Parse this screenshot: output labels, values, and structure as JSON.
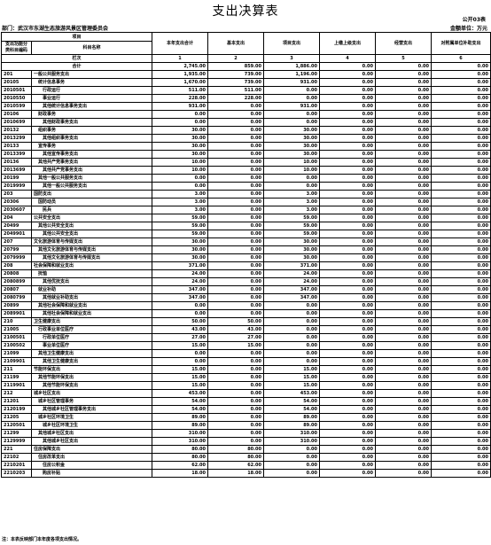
{
  "title": "支出决算表",
  "form_id": "公开03表",
  "org": "部门：武汉市东湖生态旅游风景区管理委员会",
  "unit": "金额单位：万元",
  "headers": {
    "item": "项目",
    "code": "支出功能分类科目编码",
    "name": "科目名称",
    "colno": "栏次",
    "cols": [
      "本年支出合计",
      "基本支出",
      "项目支出",
      "上缴上级支出",
      "经营支出",
      "对附属单位补助支出"
    ],
    "nums": [
      "1",
      "2",
      "3",
      "4",
      "5",
      "6"
    ]
  },
  "total": {
    "label": "合计",
    "values": [
      "2,745.00",
      "859.00",
      "1,886.00",
      "0.00",
      "0.00",
      "0.00"
    ]
  },
  "rows": [
    [
      "201",
      "一般公共服务支出",
      "1,935.00",
      "739.00",
      "1,196.00",
      "0.00",
      "0.00",
      "0.00"
    ],
    [
      "20105",
      "统计信息事务",
      "1,670.00",
      "739.00",
      "931.00",
      "0.00",
      "0.00",
      "0.00"
    ],
    [
      "2010501",
      "行政运行",
      "511.00",
      "511.00",
      "0.00",
      "0.00",
      "0.00",
      "0.00"
    ],
    [
      "2010550",
      "事业运行",
      "228.00",
      "228.00",
      "0.00",
      "0.00",
      "0.00",
      "0.00"
    ],
    [
      "2010599",
      "其他统计信息事务支出",
      "931.00",
      "0.00",
      "931.00",
      "0.00",
      "0.00",
      "0.00"
    ],
    [
      "20106",
      "财政事务",
      "0.00",
      "0.00",
      "0.00",
      "0.00",
      "0.00",
      "0.00"
    ],
    [
      "2010699",
      "其他财政事务支出",
      "0.00",
      "0.00",
      "0.00",
      "0.00",
      "0.00",
      "0.00"
    ],
    [
      "20132",
      "组织事务",
      "30.00",
      "0.00",
      "30.00",
      "0.00",
      "0.00",
      "0.00"
    ],
    [
      "2013299",
      "其他组织事务支出",
      "30.00",
      "0.00",
      "30.00",
      "0.00",
      "0.00",
      "0.00"
    ],
    [
      "20133",
      "宣传事务",
      "30.00",
      "0.00",
      "30.00",
      "0.00",
      "0.00",
      "0.00"
    ],
    [
      "2013399",
      "其他宣传事务支出",
      "30.00",
      "0.00",
      "30.00",
      "0.00",
      "0.00",
      "0.00"
    ],
    [
      "20136",
      "其他共产党事务支出",
      "10.00",
      "0.00",
      "10.00",
      "0.00",
      "0.00",
      "0.00"
    ],
    [
      "2013699",
      "其他共产党事务支出",
      "10.00",
      "0.00",
      "10.00",
      "0.00",
      "0.00",
      "0.00"
    ],
    [
      "20199",
      "其他一般公共服务支出",
      "0.00",
      "0.00",
      "0.00",
      "0.00",
      "0.00",
      "0.00"
    ],
    [
      "2019999",
      "其他一般公共服务支出",
      "0.00",
      "0.00",
      "0.00",
      "0.00",
      "0.00",
      "0.00"
    ],
    [
      "203",
      "国防支出",
      "3.00",
      "0.00",
      "3.00",
      "0.00",
      "0.00",
      "0.00"
    ],
    [
      "20306",
      "国防动员",
      "3.00",
      "0.00",
      "3.00",
      "0.00",
      "0.00",
      "0.00"
    ],
    [
      "2030607",
      "民兵",
      "3.00",
      "0.00",
      "3.00",
      "0.00",
      "0.00",
      "0.00"
    ],
    [
      "204",
      "公共安全支出",
      "59.00",
      "0.00",
      "59.00",
      "0.00",
      "0.00",
      "0.00"
    ],
    [
      "20499",
      "其他公共安全支出",
      "59.00",
      "0.00",
      "59.00",
      "0.00",
      "0.00",
      "0.00"
    ],
    [
      "2049901",
      "其他公共安全支出",
      "59.00",
      "0.00",
      "59.00",
      "0.00",
      "0.00",
      "0.00"
    ],
    [
      "207",
      "文化旅游体育与传媒支出",
      "30.00",
      "0.00",
      "30.00",
      "0.00",
      "0.00",
      "0.00"
    ],
    [
      "20799",
      "其他文化旅游体育与传媒支出",
      "30.00",
      "0.00",
      "30.00",
      "0.00",
      "0.00",
      "0.00"
    ],
    [
      "2079999",
      "其他文化旅游体育与传媒支出",
      "30.00",
      "0.00",
      "30.00",
      "0.00",
      "0.00",
      "0.00"
    ],
    [
      "208",
      "社会保障和就业支出",
      "371.00",
      "0.00",
      "371.00",
      "0.00",
      "0.00",
      "0.00"
    ],
    [
      "20808",
      "抚恤",
      "24.00",
      "0.00",
      "24.00",
      "0.00",
      "0.00",
      "0.00"
    ],
    [
      "2080899",
      "其他优抚支出",
      "24.00",
      "0.00",
      "24.00",
      "0.00",
      "0.00",
      "0.00"
    ],
    [
      "20807",
      "就业补助",
      "347.00",
      "0.00",
      "347.00",
      "0.00",
      "0.00",
      "0.00"
    ],
    [
      "2080799",
      "其他就业补助支出",
      "347.00",
      "0.00",
      "347.00",
      "0.00",
      "0.00",
      "0.00"
    ],
    [
      "20899",
      "其他社会保障和就业支出",
      "0.00",
      "0.00",
      "0.00",
      "0.00",
      "0.00",
      "0.00"
    ],
    [
      "2089901",
      "其他社会保障和就业支出",
      "0.00",
      "0.00",
      "0.00",
      "0.00",
      "0.00",
      "0.00"
    ],
    [
      "210",
      "卫生健康支出",
      "50.00",
      "50.00",
      "0.00",
      "0.00",
      "0.00",
      "0.00"
    ],
    [
      "21005",
      "行政事业单位医疗",
      "43.00",
      "43.00",
      "0.00",
      "0.00",
      "0.00",
      "0.00"
    ],
    [
      "2100501",
      "行政单位医疗",
      "27.00",
      "27.00",
      "0.00",
      "0.00",
      "0.00",
      "0.00"
    ],
    [
      "2100502",
      "事业单位医疗",
      "15.00",
      "15.00",
      "0.00",
      "0.00",
      "0.00",
      "0.00"
    ],
    [
      "21099",
      "其他卫生健康支出",
      "0.00",
      "0.00",
      "0.00",
      "0.00",
      "0.00",
      "0.00"
    ],
    [
      "2109901",
      "其他卫生健康支出",
      "0.00",
      "0.00",
      "0.00",
      "0.00",
      "0.00",
      "0.00"
    ],
    [
      "211",
      "节能环保支出",
      "15.00",
      "0.00",
      "15.00",
      "0.00",
      "0.00",
      "0.00"
    ],
    [
      "21199",
      "其他节能环保支出",
      "15.00",
      "0.00",
      "15.00",
      "0.00",
      "0.00",
      "0.00"
    ],
    [
      "2119901",
      "其他节能环保支出",
      "15.00",
      "0.00",
      "15.00",
      "0.00",
      "0.00",
      "0.00"
    ],
    [
      "212",
      "城乡社区支出",
      "453.00",
      "0.00",
      "453.00",
      "0.00",
      "0.00",
      "0.00"
    ],
    [
      "21201",
      "城乡社区管理事务",
      "54.00",
      "0.00",
      "54.00",
      "0.00",
      "0.00",
      "0.00"
    ],
    [
      "2120199",
      "其他城乡社区管理事务支出",
      "54.00",
      "0.00",
      "54.00",
      "0.00",
      "0.00",
      "0.00"
    ],
    [
      "21205",
      "城乡社区环境卫生",
      "89.00",
      "0.00",
      "89.00",
      "0.00",
      "0.00",
      "0.00"
    ],
    [
      "2120501",
      "城乡社区环境卫生",
      "89.00",
      "0.00",
      "89.00",
      "0.00",
      "0.00",
      "0.00"
    ],
    [
      "21299",
      "其他城乡社区支出",
      "310.00",
      "0.00",
      "310.00",
      "0.00",
      "0.00",
      "0.00"
    ],
    [
      "2129999",
      "其他城乡社区支出",
      "310.00",
      "0.00",
      "310.00",
      "0.00",
      "0.00",
      "0.00"
    ],
    [
      "221",
      "住房保障支出",
      "80.00",
      "80.00",
      "0.00",
      "0.00",
      "0.00",
      "0.00"
    ],
    [
      "22102",
      "住房改革支出",
      "80.00",
      "80.00",
      "0.00",
      "0.00",
      "0.00",
      "0.00"
    ],
    [
      "2210201",
      "住房公积金",
      "62.00",
      "62.00",
      "0.00",
      "0.00",
      "0.00",
      "0.00"
    ],
    [
      "2210203",
      "购房补贴",
      "18.00",
      "18.00",
      "0.00",
      "0.00",
      "0.00",
      "0.00"
    ]
  ],
  "footer": "注：本表反映部门本年度各项支出情况。"
}
